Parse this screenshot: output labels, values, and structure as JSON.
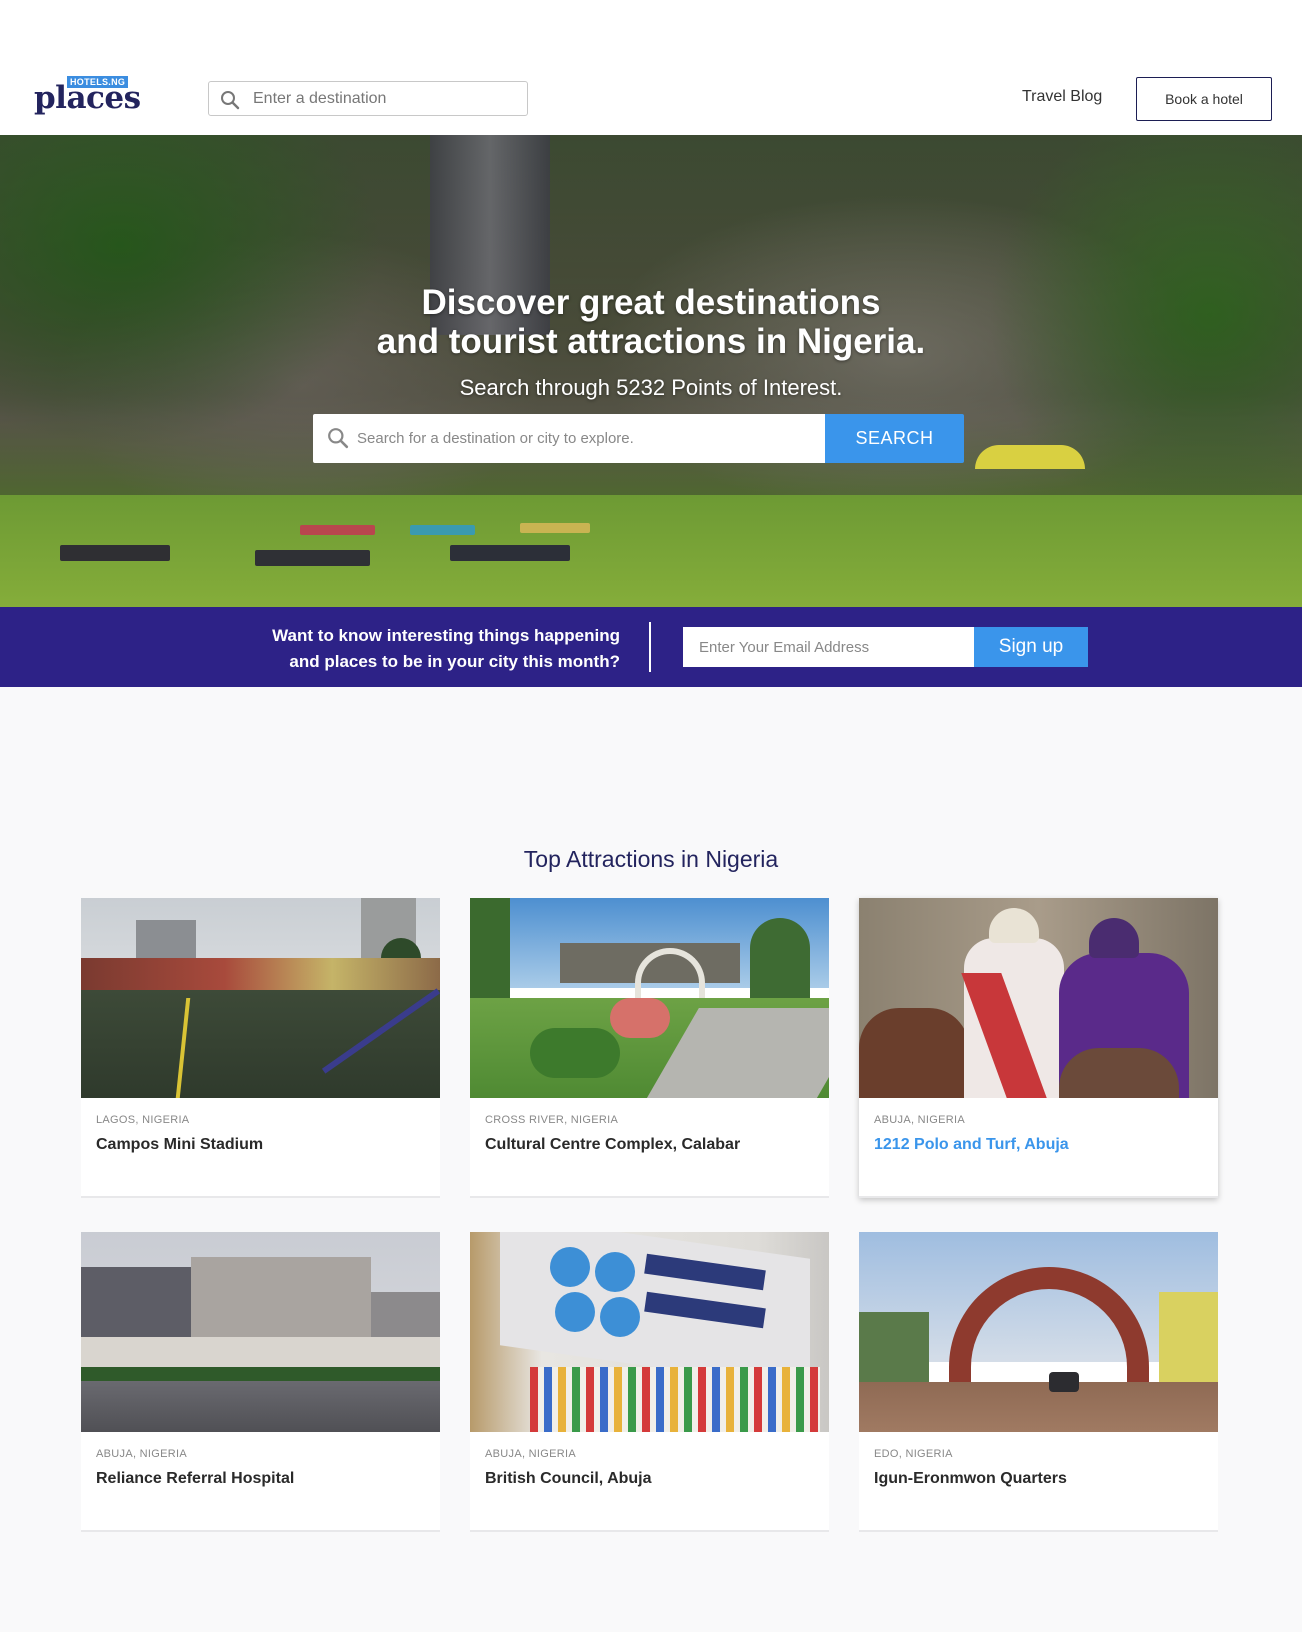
{
  "header": {
    "logo_badge": "HOTELS.NG",
    "logo_word": "places",
    "search_placeholder": "Enter a destination",
    "travel_blog": "Travel Blog",
    "book_hotel": "Book a hotel"
  },
  "hero": {
    "title_line1": "Discover great destinations",
    "title_line2": "and tourist attractions in Nigeria.",
    "subtitle": "Search through 5232 Points of Interest.",
    "search_placeholder": "Search for a destination or city to explore.",
    "search_button": "SEARCH"
  },
  "newsletter": {
    "line1": "Want to know interesting things happening",
    "line2": "and places to be in your city this month?",
    "email_placeholder": "Enter Your Email Address",
    "button": "Sign up"
  },
  "attractions": {
    "title": "Top Attractions in Nigeria",
    "cards": [
      {
        "location": "LAGOS, NIGERIA",
        "name": "Campos Mini Stadium"
      },
      {
        "location": "CROSS RIVER, NIGERIA",
        "name": "Cultural Centre Complex, Calabar"
      },
      {
        "location": "ABUJA, NIGERIA",
        "name": "1212 Polo and Turf, Abuja"
      },
      {
        "location": "ABUJA, NIGERIA",
        "name": "Reliance Referral Hospital"
      },
      {
        "location": "ABUJA, NIGERIA",
        "name": "British Council, Abuja"
      },
      {
        "location": "EDO, NIGERIA",
        "name": "Igun-Eronmwon Quarters"
      }
    ]
  },
  "colors": {
    "brand_navy": "#23245e",
    "band_purple": "#2d2287",
    "accent_blue": "#3a95eb"
  },
  "icons": {
    "nav_search": "search-icon",
    "hero_search": "search-icon"
  }
}
